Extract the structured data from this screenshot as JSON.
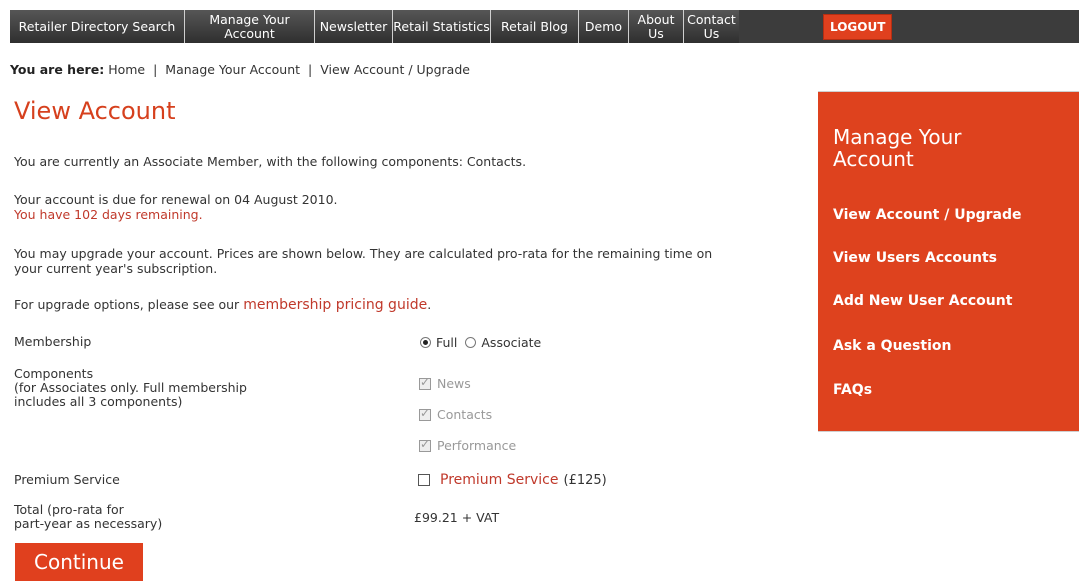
{
  "nav": {
    "items": [
      {
        "label": "Retailer Directory Search"
      },
      {
        "label": "Manage Your Account"
      },
      {
        "label": "Newsletter"
      },
      {
        "label": "Retail Statistics"
      },
      {
        "label": "Retail Blog"
      },
      {
        "label": "Demo"
      },
      {
        "label": "About Us"
      },
      {
        "label": "Contact Us"
      }
    ],
    "logout": "LOGOUT"
  },
  "breadcrumb": {
    "prefix": "You are here:",
    "items": [
      "Home",
      "Manage Your Account",
      "View Account / Upgrade"
    ],
    "separator": "|"
  },
  "page_title": "View Account",
  "intro": {
    "membership_text": "You are currently an Associate Member, with the following components: Contacts.",
    "renewal_text": "Your account is due for renewal on 04 August 2010.",
    "remaining_text": "You have 102 days remaining.",
    "upgrade_line1": "You may upgrade your account. Prices are shown below. They are calculated pro-rata for the remaining time on",
    "upgrade_line2": "your current year's subscription.",
    "pricing_prefix": "For upgrade options, please see our",
    "pricing_link": "membership pricing guide",
    "pricing_suffix": "."
  },
  "form": {
    "membership_label": "Membership",
    "membership_options": [
      {
        "label": "Full",
        "selected": true
      },
      {
        "label": "Associate",
        "selected": false
      }
    ],
    "components_label": "Components",
    "components_note1": "(for Associates only. Full membership",
    "components_note2": "includes all 3 components)",
    "components": [
      {
        "label": "News",
        "checked": true,
        "disabled": true
      },
      {
        "label": "Contacts",
        "checked": true,
        "disabled": true
      },
      {
        "label": "Performance",
        "checked": true,
        "disabled": true
      }
    ],
    "premium_label": "Premium Service",
    "premium_link": "Premium Service",
    "premium_price": "(£125)",
    "total_label1": "Total (pro-rata for",
    "total_label2": "part-year as necessary)",
    "total_value": "£99.21 + VAT",
    "continue": "Continue"
  },
  "sidebar": {
    "title_line1": "Manage Your",
    "title_line2": "Account",
    "links": [
      "View Account / Upgrade",
      "View Users Accounts",
      "Add New User Account",
      "Ask a Question",
      "FAQs"
    ]
  },
  "colors": {
    "accent": "#de421e",
    "nav_bg": "#3c3c3c",
    "link_red": "#c0392b"
  }
}
